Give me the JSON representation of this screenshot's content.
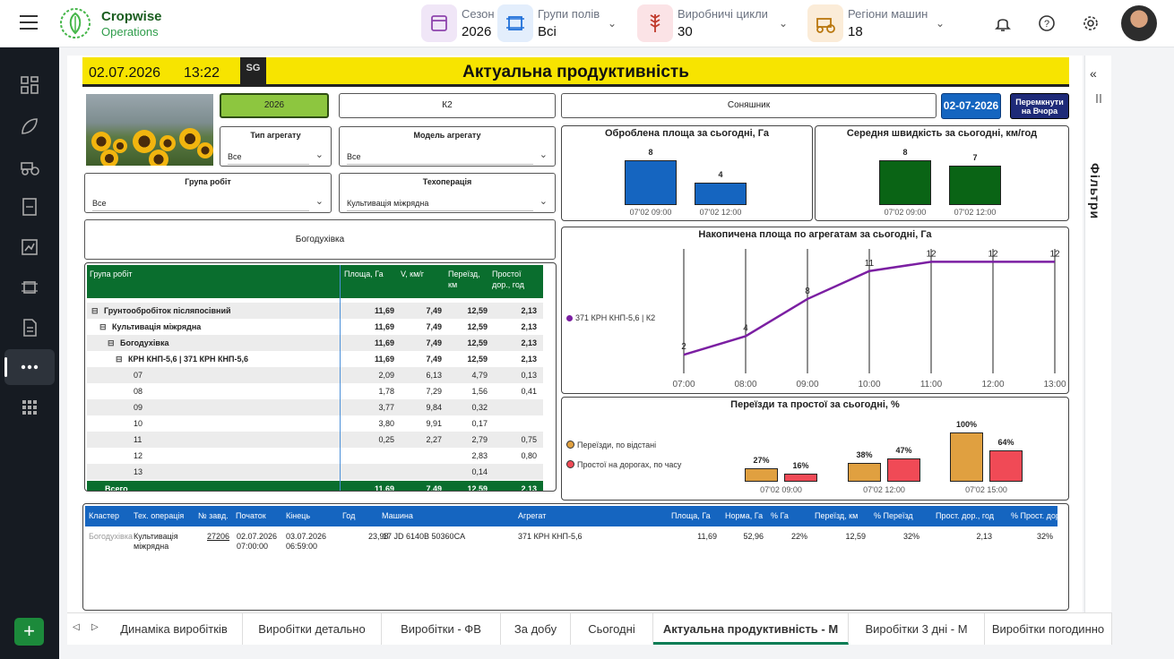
{
  "topbar": {
    "brand_line1": "Cropwise",
    "brand_line2": "Operations",
    "selectors": [
      {
        "label": "Сезон",
        "value": "2026",
        "icon": "calendar-icon",
        "color": "#f0e6f7"
      },
      {
        "label": "Групи полів",
        "value": "Всі",
        "icon": "field-group-icon",
        "color": "#e3eefc"
      },
      {
        "label": "Виробничі цикли",
        "value": "30",
        "icon": "crop-cycle-icon",
        "color": "#fbe3e6"
      },
      {
        "label": "Регіони машин",
        "value": "18",
        "icon": "machine-region-icon",
        "color": "#fbecd8"
      }
    ]
  },
  "rightpanel": {
    "collapse": "«",
    "label": "Фільтри"
  },
  "report": {
    "date": "02.07.2026",
    "time": "13:22",
    "logo_text": "SG",
    "title": "Актуальна продуктивність",
    "year_btn": "2026",
    "field_btn": "К2",
    "crop_btn": "Соняшник",
    "date_btn": "02-07-2026",
    "yesterday_btn": "Перемкнути на Вчора",
    "cluster_btn": "Богодухівка",
    "dropdowns": [
      {
        "label": "Тип агрегату",
        "value": "Все"
      },
      {
        "label": "Модель агрегату",
        "value": "Все"
      },
      {
        "label": "Група робіт",
        "value": "Все"
      },
      {
        "label": "Техоперація",
        "value": "Культивація міжрядна"
      }
    ]
  },
  "chart_area": {
    "title": "Оброблена площа за сьогодні, Га",
    "type": "bar",
    "categories": [
      "07'02 09:00",
      "07'02 12:00"
    ],
    "values": [
      8,
      4
    ],
    "color": "#1565c0"
  },
  "chart_speed": {
    "title": "Середня швидкість за сьогодні, км/год",
    "type": "bar",
    "categories": [
      "07'02 09:00",
      "07'02 12:00"
    ],
    "values": [
      8,
      7
    ],
    "color": "#0a6415"
  },
  "chart_cum": {
    "title": "Накопичена площа по агрегатам за сьогодні, Га",
    "type": "line",
    "series_name": "371 КРН КНП-5,6 | К2",
    "x": [
      "07:00",
      "08:00",
      "09:00",
      "10:00",
      "11:00",
      "12:00",
      "13:00"
    ],
    "values": [
      2,
      4,
      8,
      11,
      12,
      12,
      12
    ],
    "color": "#7b1fa2"
  },
  "chart_moves": {
    "title": "Переїзди та простої за сьогодні, %",
    "type": "bar",
    "legend": [
      "Переїзди, по відстані",
      "Простої на  дорогах, по часу"
    ],
    "colors": [
      "#e0a040",
      "#f04a56"
    ],
    "categories": [
      "07'02 09:00",
      "07'02 12:00",
      "07'02 15:00"
    ],
    "series": [
      {
        "name": "Переїзди, по відстані",
        "values": [
          27,
          38,
          100
        ]
      },
      {
        "name": "Простої на  дорогах, по часу",
        "values": [
          16,
          47,
          64
        ]
      }
    ],
    "labels": [
      [
        "27%",
        "16%"
      ],
      [
        "38%",
        "47%"
      ],
      [
        "100%",
        "64%"
      ]
    ]
  },
  "matrix": {
    "headers": [
      "Група робіт",
      "Площа, Га",
      "V, км/г",
      "Переїзд, км",
      "Простої дор., год"
    ],
    "rows": [
      {
        "indent": 0,
        "sym": "⊟",
        "name": "Грунтообробіток післяпосівний",
        "bold": true,
        "v": [
          "11,69",
          "7,49",
          "12,59",
          "2,13"
        ]
      },
      {
        "indent": 1,
        "sym": "⊟",
        "name": "Культивація міжрядна",
        "bold": true,
        "v": [
          "11,69",
          "7,49",
          "12,59",
          "2,13"
        ]
      },
      {
        "indent": 2,
        "sym": "⊟",
        "name": "Богодухівка",
        "bold": true,
        "v": [
          "11,69",
          "7,49",
          "12,59",
          "2,13"
        ]
      },
      {
        "indent": 3,
        "sym": "⊟",
        "name": "КРН КНП-5,6 | 371 КРН КНП-5,6",
        "bold": true,
        "v": [
          "11,69",
          "7,49",
          "12,59",
          "2,13"
        ]
      },
      {
        "indent": 4,
        "sym": "",
        "name": "07",
        "bold": false,
        "v": [
          "2,09",
          "6,13",
          "4,79",
          "0,13"
        ]
      },
      {
        "indent": 4,
        "sym": "",
        "name": "08",
        "bold": false,
        "v": [
          "1,78",
          "7,29",
          "1,56",
          "0,41"
        ]
      },
      {
        "indent": 4,
        "sym": "",
        "name": "09",
        "bold": false,
        "v": [
          "3,77",
          "9,84",
          "0,32",
          ""
        ]
      },
      {
        "indent": 4,
        "sym": "",
        "name": "10",
        "bold": false,
        "v": [
          "3,80",
          "9,91",
          "0,17",
          ""
        ]
      },
      {
        "indent": 4,
        "sym": "",
        "name": "11",
        "bold": false,
        "v": [
          "0,25",
          "2,27",
          "2,79",
          "0,75"
        ]
      },
      {
        "indent": 4,
        "sym": "",
        "name": "12",
        "bold": false,
        "v": [
          "",
          "",
          "2,83",
          "0,80"
        ]
      },
      {
        "indent": 4,
        "sym": "",
        "name": "13",
        "bold": false,
        "v": [
          "",
          "",
          "0,14",
          ""
        ]
      }
    ],
    "total": {
      "name": "Всего",
      "v": [
        "11,69",
        "7,49",
        "12,59",
        "2,13"
      ]
    }
  },
  "table": {
    "headers": [
      "Кластер",
      "Тех. операція",
      "№ завд.",
      "Початок",
      "Кінець",
      "Год",
      "Машина",
      "Агрегат",
      "Площа, Га",
      "Норма, Га",
      "% Га",
      "Переїзд, км",
      "% Переїзд",
      "Прост. дор., год",
      "% Прост. дор."
    ],
    "row": [
      "Богодухівка",
      "Культивація міжрядна",
      "27206",
      "02.07.2026 07:00:00",
      "03.07.2026 06:59:00",
      "23,98",
      "17 JD 6140B 50360CA",
      "371 КРН КНП-5,6",
      "11,69",
      "52,96",
      "22%",
      "12,59",
      "32%",
      "2,13",
      "32%"
    ]
  },
  "tabs": [
    "Динаміка виробітків",
    "Виробітки детально",
    "Виробітки - ФВ",
    "За добу",
    "Сьогодні",
    "Актуальна продуктивність - М",
    "Виробітки 3 дні - М",
    "Виробітки погодинно"
  ],
  "tab_nav": [
    "◁",
    "▷"
  ],
  "plus": "+"
}
